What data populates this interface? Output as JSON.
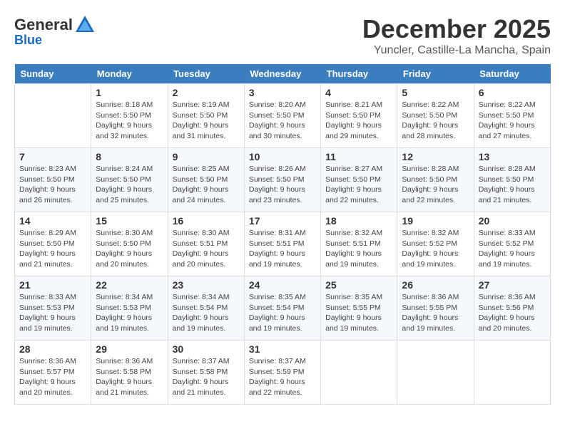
{
  "logo": {
    "general": "General",
    "blue": "Blue"
  },
  "header": {
    "month": "December 2025",
    "location": "Yuncler, Castille-La Mancha, Spain"
  },
  "weekdays": [
    "Sunday",
    "Monday",
    "Tuesday",
    "Wednesday",
    "Thursday",
    "Friday",
    "Saturday"
  ],
  "weeks": [
    [
      {
        "day": "",
        "sunrise": "",
        "sunset": "",
        "daylight": ""
      },
      {
        "day": "1",
        "sunrise": "Sunrise: 8:18 AM",
        "sunset": "Sunset: 5:50 PM",
        "daylight": "Daylight: 9 hours and 32 minutes."
      },
      {
        "day": "2",
        "sunrise": "Sunrise: 8:19 AM",
        "sunset": "Sunset: 5:50 PM",
        "daylight": "Daylight: 9 hours and 31 minutes."
      },
      {
        "day": "3",
        "sunrise": "Sunrise: 8:20 AM",
        "sunset": "Sunset: 5:50 PM",
        "daylight": "Daylight: 9 hours and 30 minutes."
      },
      {
        "day": "4",
        "sunrise": "Sunrise: 8:21 AM",
        "sunset": "Sunset: 5:50 PM",
        "daylight": "Daylight: 9 hours and 29 minutes."
      },
      {
        "day": "5",
        "sunrise": "Sunrise: 8:22 AM",
        "sunset": "Sunset: 5:50 PM",
        "daylight": "Daylight: 9 hours and 28 minutes."
      },
      {
        "day": "6",
        "sunrise": "Sunrise: 8:22 AM",
        "sunset": "Sunset: 5:50 PM",
        "daylight": "Daylight: 9 hours and 27 minutes."
      }
    ],
    [
      {
        "day": "7",
        "sunrise": "Sunrise: 8:23 AM",
        "sunset": "Sunset: 5:50 PM",
        "daylight": "Daylight: 9 hours and 26 minutes."
      },
      {
        "day": "8",
        "sunrise": "Sunrise: 8:24 AM",
        "sunset": "Sunset: 5:50 PM",
        "daylight": "Daylight: 9 hours and 25 minutes."
      },
      {
        "day": "9",
        "sunrise": "Sunrise: 8:25 AM",
        "sunset": "Sunset: 5:50 PM",
        "daylight": "Daylight: 9 hours and 24 minutes."
      },
      {
        "day": "10",
        "sunrise": "Sunrise: 8:26 AM",
        "sunset": "Sunset: 5:50 PM",
        "daylight": "Daylight: 9 hours and 23 minutes."
      },
      {
        "day": "11",
        "sunrise": "Sunrise: 8:27 AM",
        "sunset": "Sunset: 5:50 PM",
        "daylight": "Daylight: 9 hours and 22 minutes."
      },
      {
        "day": "12",
        "sunrise": "Sunrise: 8:28 AM",
        "sunset": "Sunset: 5:50 PM",
        "daylight": "Daylight: 9 hours and 22 minutes."
      },
      {
        "day": "13",
        "sunrise": "Sunrise: 8:28 AM",
        "sunset": "Sunset: 5:50 PM",
        "daylight": "Daylight: 9 hours and 21 minutes."
      }
    ],
    [
      {
        "day": "14",
        "sunrise": "Sunrise: 8:29 AM",
        "sunset": "Sunset: 5:50 PM",
        "daylight": "Daylight: 9 hours and 21 minutes."
      },
      {
        "day": "15",
        "sunrise": "Sunrise: 8:30 AM",
        "sunset": "Sunset: 5:50 PM",
        "daylight": "Daylight: 9 hours and 20 minutes."
      },
      {
        "day": "16",
        "sunrise": "Sunrise: 8:30 AM",
        "sunset": "Sunset: 5:51 PM",
        "daylight": "Daylight: 9 hours and 20 minutes."
      },
      {
        "day": "17",
        "sunrise": "Sunrise: 8:31 AM",
        "sunset": "Sunset: 5:51 PM",
        "daylight": "Daylight: 9 hours and 19 minutes."
      },
      {
        "day": "18",
        "sunrise": "Sunrise: 8:32 AM",
        "sunset": "Sunset: 5:51 PM",
        "daylight": "Daylight: 9 hours and 19 minutes."
      },
      {
        "day": "19",
        "sunrise": "Sunrise: 8:32 AM",
        "sunset": "Sunset: 5:52 PM",
        "daylight": "Daylight: 9 hours and 19 minutes."
      },
      {
        "day": "20",
        "sunrise": "Sunrise: 8:33 AM",
        "sunset": "Sunset: 5:52 PM",
        "daylight": "Daylight: 9 hours and 19 minutes."
      }
    ],
    [
      {
        "day": "21",
        "sunrise": "Sunrise: 8:33 AM",
        "sunset": "Sunset: 5:53 PM",
        "daylight": "Daylight: 9 hours and 19 minutes."
      },
      {
        "day": "22",
        "sunrise": "Sunrise: 8:34 AM",
        "sunset": "Sunset: 5:53 PM",
        "daylight": "Daylight: 9 hours and 19 minutes."
      },
      {
        "day": "23",
        "sunrise": "Sunrise: 8:34 AM",
        "sunset": "Sunset: 5:54 PM",
        "daylight": "Daylight: 9 hours and 19 minutes."
      },
      {
        "day": "24",
        "sunrise": "Sunrise: 8:35 AM",
        "sunset": "Sunset: 5:54 PM",
        "daylight": "Daylight: 9 hours and 19 minutes."
      },
      {
        "day": "25",
        "sunrise": "Sunrise: 8:35 AM",
        "sunset": "Sunset: 5:55 PM",
        "daylight": "Daylight: 9 hours and 19 minutes."
      },
      {
        "day": "26",
        "sunrise": "Sunrise: 8:36 AM",
        "sunset": "Sunset: 5:55 PM",
        "daylight": "Daylight: 9 hours and 19 minutes."
      },
      {
        "day": "27",
        "sunrise": "Sunrise: 8:36 AM",
        "sunset": "Sunset: 5:56 PM",
        "daylight": "Daylight: 9 hours and 20 minutes."
      }
    ],
    [
      {
        "day": "28",
        "sunrise": "Sunrise: 8:36 AM",
        "sunset": "Sunset: 5:57 PM",
        "daylight": "Daylight: 9 hours and 20 minutes."
      },
      {
        "day": "29",
        "sunrise": "Sunrise: 8:36 AM",
        "sunset": "Sunset: 5:58 PM",
        "daylight": "Daylight: 9 hours and 21 minutes."
      },
      {
        "day": "30",
        "sunrise": "Sunrise: 8:37 AM",
        "sunset": "Sunset: 5:58 PM",
        "daylight": "Daylight: 9 hours and 21 minutes."
      },
      {
        "day": "31",
        "sunrise": "Sunrise: 8:37 AM",
        "sunset": "Sunset: 5:59 PM",
        "daylight": "Daylight: 9 hours and 22 minutes."
      },
      {
        "day": "",
        "sunrise": "",
        "sunset": "",
        "daylight": ""
      },
      {
        "day": "",
        "sunrise": "",
        "sunset": "",
        "daylight": ""
      },
      {
        "day": "",
        "sunrise": "",
        "sunset": "",
        "daylight": ""
      }
    ]
  ]
}
